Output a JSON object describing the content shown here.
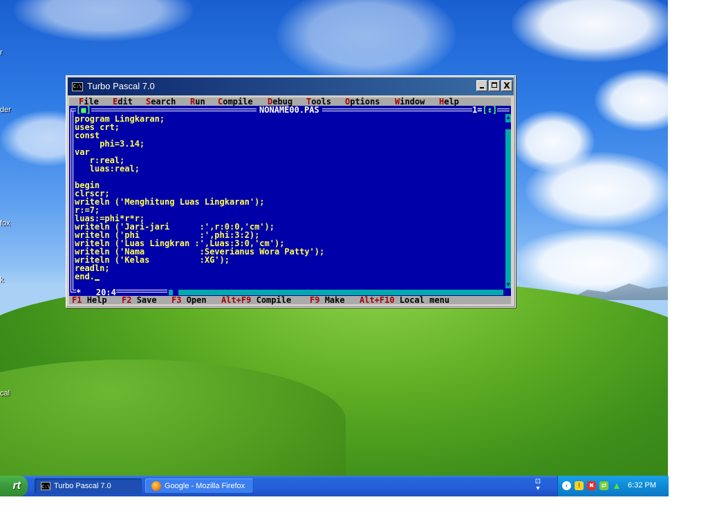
{
  "desktop": {
    "icon_labels": [
      "r",
      "der",
      "",
      "fox",
      "k",
      "cal"
    ]
  },
  "window": {
    "title": "Turbo Pascal 7.0",
    "system_icon": "C:\\",
    "controls": {
      "minimize_icon": "minimize-icon",
      "maximize_icon": "maximize-icon",
      "close_icon": "close-icon",
      "close_label": "X"
    }
  },
  "menu": [
    {
      "hot": "F",
      "rest": "ile"
    },
    {
      "hot": "E",
      "rest": "dit"
    },
    {
      "hot": "S",
      "rest": "earch"
    },
    {
      "hot": "R",
      "rest": "un"
    },
    {
      "hot": "C",
      "rest": "ompile"
    },
    {
      "hot": "D",
      "rest": "ebug"
    },
    {
      "hot": "T",
      "rest": "ools"
    },
    {
      "hot": "O",
      "rest": "ptions"
    },
    {
      "hot": "W",
      "rest": "indow"
    },
    {
      "hot": "H",
      "rest": "elp"
    }
  ],
  "editor": {
    "filename": "NONAME00.PAS",
    "close_box": "[■]",
    "window_number": "1",
    "zoom_box": "[↕]",
    "cursor_position": "20:4",
    "modified_marker": "*",
    "code_lines": [
      "program Lingkaran;",
      "uses crt;",
      "const",
      "     phi=3.14;",
      "var",
      "   r:real;",
      "   luas:real;",
      "",
      "begin",
      "clrscr;",
      "writeln ('Menghitung Luas Lingkaran');",
      "r:=7;",
      "luas:=phi*r*r;",
      "writeln ('Jari-jari      :',r:0:0,'cm');",
      "writeln ('phi            :',phi:3:2);",
      "writeln ('Luas Lingkran :',Luas:3:0,'cm');",
      "writeln ('Nama           :Severianus Wora Patty');",
      "writeln ('Kelas          :XG');",
      "readln;",
      "end."
    ]
  },
  "hints": [
    {
      "key": "F1",
      "label": "Help"
    },
    {
      "key": "F2",
      "label": "Save"
    },
    {
      "key": "F3",
      "label": "Open"
    },
    {
      "key": "Alt+F9",
      "label": "Compile"
    },
    {
      "key": "F9",
      "label": "Make"
    },
    {
      "key": "Alt+F10",
      "label": "Local menu"
    }
  ],
  "taskbar": {
    "start_label": "rt",
    "tasks": [
      {
        "label": "Turbo Pascal 7.0",
        "icon": "console-icon",
        "active": true
      },
      {
        "label": "Google - Mozilla Firefox",
        "icon": "firefox-icon",
        "active": false
      }
    ],
    "tray_icons": [
      "show-hidden-icon",
      "security-shield-icon",
      "antivirus-icon",
      "network-icon",
      "update-icon"
    ],
    "clock": "6:32 PM"
  },
  "colors": {
    "dos_background": "#0000a8",
    "code_text": "#ffff55",
    "menu_background": "#aaaaaa",
    "hotkey": "#a80000",
    "scrollbar": "#00aaaa"
  }
}
